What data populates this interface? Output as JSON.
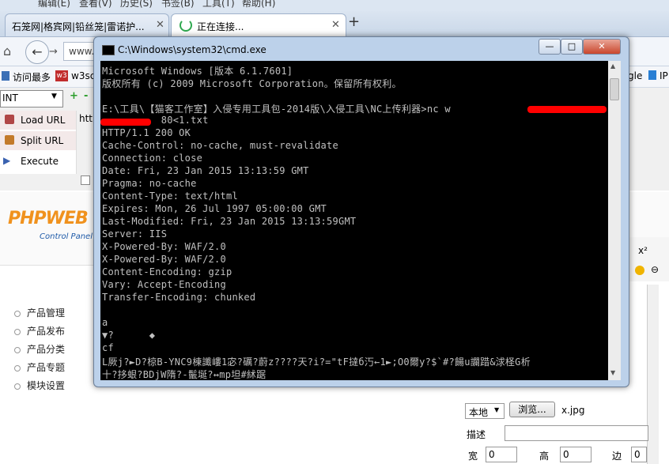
{
  "browser": {
    "menu": [
      "编辑(E)",
      "查看(V)",
      "历史(S)",
      "书签(B)",
      "工具(T)",
      "帮助(H)"
    ],
    "tabs": [
      {
        "label": "石笼网|格宾网|铅丝笼|雷诺护..."
      },
      {
        "label": "正在连接..."
      }
    ],
    "address_partial": "www.",
    "bookmarks": [
      {
        "label": "访问最多"
      },
      {
        "label": "w3sc"
      },
      {
        "label": "gle"
      },
      {
        "label": "IP"
      }
    ]
  },
  "hackbar": {
    "select_value": "INT",
    "commands": [
      {
        "label": "Load URL"
      },
      {
        "label": "Split URL"
      },
      {
        "label": "Execute"
      }
    ],
    "url_partial": "htt"
  },
  "cms": {
    "logo_main": "PHPWEB",
    "logo_sub": "Control Panel",
    "menu": [
      "产品管理",
      "产品发布",
      "产品分类",
      "产品专题",
      "模块设置"
    ],
    "upload": {
      "select_value": "本地",
      "browse_label": "浏览...",
      "filename": "x.jpg",
      "desc_label": "描述",
      "width_label": "宽",
      "width_value": "0",
      "height_label": "高",
      "height_value": "0",
      "border_label": "边",
      "border_value": "0"
    }
  },
  "cmd": {
    "title": "C:\\Windows\\system32\\cmd.exe",
    "lines": [
      "Microsoft Windows [版本 6.1.7601]",
      "版权所有 (c) 2009 Microsoft Corporation。保留所有权利。",
      "",
      "E:\\工具\\【猫客工作室】入侵专用工具包-2014版\\入侵工具\\NC上传利器>nc w",
      "          80<1.txt",
      "HTTP/1.1 200 OK",
      "Cache-Control: no-cache, must-revalidate",
      "Connection: close",
      "Date: Fri, 23 Jan 2015 13:13:59 GMT",
      "Pragma: no-cache",
      "Content-Type: text/html",
      "Expires: Mon, 26 Jul 1997 05:00:00 GMT",
      "Last-Modified: Fri, 23 Jan 2015 13:13:59GMT",
      "Server: IIS",
      "X-Powered-By: WAF/2.0",
      "X-Powered-By: WAF/2.0",
      "Content-Encoding: gzip",
      "Vary: Accept-Encoding",
      "Transfer-Encoding: chunked",
      "",
      "a",
      "▼?      ◆",
      "cf",
      "L厥j?►D?椋B-YNC9棟讖嶁1宓?礪?蔚z????天?i?=\"tF撻б汅←1►;O0爾y?$`#?餳u讕踖&浗柽G析",
      "十?拸蛝?BDjW隋?-鬛埏?↔mp坦#絉踞"
    ]
  },
  "colors": {
    "cmd_bg": "#000000",
    "cmd_text": "#c0c0c0",
    "redaction": "#ff0000",
    "window_frame": "#bcd1ea"
  }
}
